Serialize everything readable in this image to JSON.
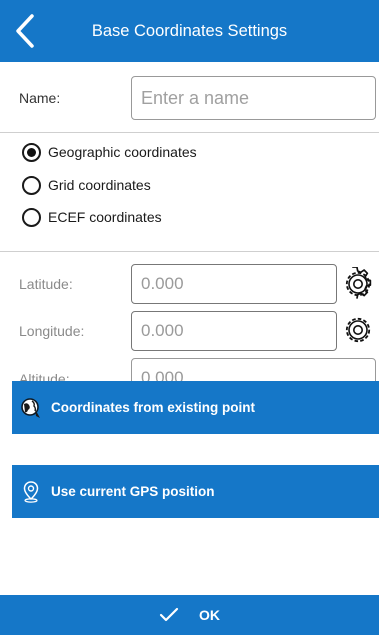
{
  "header": {
    "title": "Base Coordinates Settings",
    "back_icon": "chevron-left-icon"
  },
  "name_field": {
    "label": "Name:",
    "value": "",
    "placeholder": "Enter a name"
  },
  "coordinate_types": [
    {
      "label": "Geographic coordinates",
      "selected": true
    },
    {
      "label": "Grid coordinates",
      "selected": false
    },
    {
      "label": "ECEF coordinates",
      "selected": false
    }
  ],
  "coordinates": {
    "latitude": {
      "label": "Latitude:",
      "value": "0.000",
      "icon": "gear-icon"
    },
    "longitude": {
      "label": "Longitude:",
      "value": "0.000",
      "icon": "gear-icon"
    },
    "altitude": {
      "label": "Altitude:",
      "value": "0.000"
    }
  },
  "actions": {
    "existing_point": {
      "label": "Coordinates from existing point",
      "icon": "globe-pin-icon"
    },
    "gps_position": {
      "label": "Use current GPS position",
      "icon": "location-pin-icon"
    }
  },
  "footer": {
    "ok_label": "OK",
    "ok_icon": "checkmark-icon"
  },
  "colors": {
    "accent": "#1577c8",
    "divider": "#cfcfcf",
    "text_muted": "#8a8a8a"
  }
}
